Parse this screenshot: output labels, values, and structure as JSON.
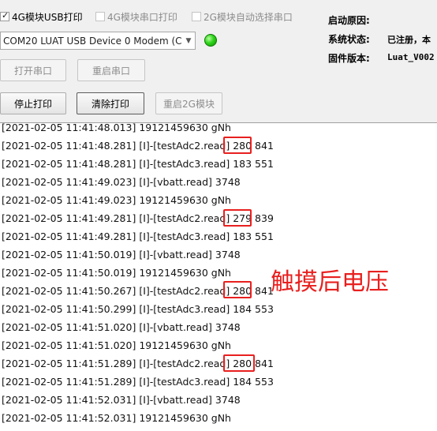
{
  "options": {
    "usb_print": "4G模块USB打印",
    "serial_print": "4G模块串口打印",
    "auto_select": "2G模块自动选择串口",
    "usb_print_checked": true
  },
  "port": {
    "selected": "COM20 LUAT USB Device 0 Modem (C",
    "status_color": "#2fd41c"
  },
  "buttons": {
    "open_port": "打开串口",
    "restart_port": "重启串口",
    "stop_print": "停止打印",
    "clear_print": "清除打印",
    "restart_2g": "重启2G模块"
  },
  "info": {
    "boot_reason_label": "启动原因:",
    "boot_reason_value": "",
    "system_status_label": "系统状态:",
    "system_status_value": "已注册，本",
    "firmware_label": "固件版本:",
    "firmware_value": "Luat_V002"
  },
  "log": [
    "[2021-02-05 11:41:48.013] 19121459630 gNh",
    "[2021-02-05 11:41:48.281] [I]-[testAdc2.read] 280 841",
    "[2021-02-05 11:41:48.281] [I]-[testAdc3.read] 183 551",
    "[2021-02-05 11:41:49.023] [I]-[vbatt.read] 3748",
    "[2021-02-05 11:41:49.023] 19121459630 gNh",
    "[2021-02-05 11:41:49.281] [I]-[testAdc2.read] 279 839",
    "[2021-02-05 11:41:49.281] [I]-[testAdc3.read] 183 551",
    "[2021-02-05 11:41:50.019] [I]-[vbatt.read] 3748",
    "[2021-02-05 11:41:50.019] 19121459630 gNh",
    "[2021-02-05 11:41:50.267] [I]-[testAdc2.read] 280 841",
    "[2021-02-05 11:41:50.299] [I]-[testAdc3.read] 184 553",
    "[2021-02-05 11:41:51.020] [I]-[vbatt.read] 3748",
    "[2021-02-05 11:41:51.020] 19121459630 gNh",
    "[2021-02-05 11:41:51.289] [I]-[testAdc2.read] 280 841",
    "[2021-02-05 11:41:51.289] [I]-[testAdc3.read] 184 553",
    "[2021-02-05 11:41:52.031] [I]-[vbatt.read] 3748",
    "[2021-02-05 11:41:52.031] 19121459630 gNh"
  ],
  "annotation": {
    "text": "触摸后电压",
    "color": "#e8201f"
  }
}
